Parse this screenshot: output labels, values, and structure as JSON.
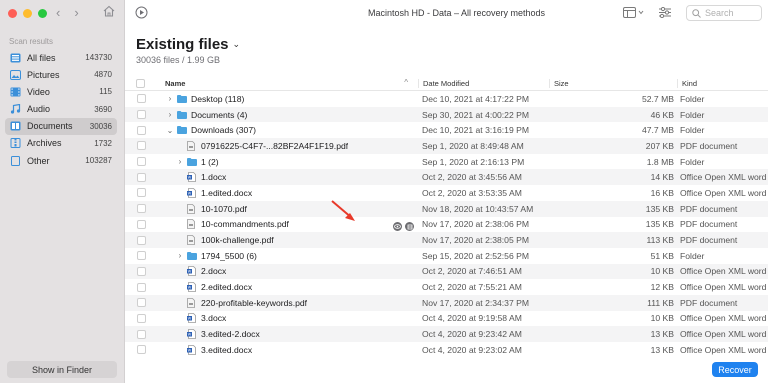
{
  "window": {
    "title": "Macintosh HD - Data – All recovery methods"
  },
  "search": {
    "placeholder": "Search"
  },
  "sidebar": {
    "header": "Scan results",
    "items": [
      {
        "label": "All files",
        "count": "143730",
        "icon": "all-files-icon"
      },
      {
        "label": "Pictures",
        "count": "4870",
        "icon": "pictures-icon"
      },
      {
        "label": "Video",
        "count": "115",
        "icon": "video-icon"
      },
      {
        "label": "Audio",
        "count": "3690",
        "icon": "audio-icon"
      },
      {
        "label": "Documents",
        "count": "30036",
        "icon": "documents-icon",
        "active": true
      },
      {
        "label": "Archives",
        "count": "1732",
        "icon": "archives-icon"
      },
      {
        "label": "Other",
        "count": "103287",
        "icon": "other-icon"
      }
    ],
    "finder_button": "Show in Finder"
  },
  "main": {
    "title": "Existing files",
    "subtitle": "30036 files / 1.99 GB"
  },
  "table": {
    "columns": {
      "name": "Name",
      "date": "Date Modified",
      "size": "Size",
      "kind": "Kind"
    },
    "rows": [
      {
        "name": "Desktop (118)",
        "date": "Dec 10, 2021 at 4:17:22 PM",
        "size": "52.7 MB",
        "kind": "Folder",
        "type": "folder",
        "disc": "›"
      },
      {
        "name": "Documents (4)",
        "date": "Sep 30, 2021 at 4:00:22 PM",
        "size": "46 KB",
        "kind": "Folder",
        "type": "folder",
        "disc": "›"
      },
      {
        "name": "Downloads (307)",
        "date": "Dec 10, 2021 at 3:16:19 PM",
        "size": "47.7 MB",
        "kind": "Folder",
        "type": "folder",
        "disc": "⌄"
      },
      {
        "name": "07916225-C4F7-...82BF2A4F1F19.pdf",
        "date": "Sep 1, 2020 at 8:49:48 AM",
        "size": "207 KB",
        "kind": "PDF document",
        "type": "pdf"
      },
      {
        "name": "1 (2)",
        "date": "Sep 1, 2020 at 2:16:13 PM",
        "size": "1.8 MB",
        "kind": "Folder",
        "type": "folder",
        "disc": "›"
      },
      {
        "name": "1.docx",
        "date": "Oct 2, 2020 at 3:45:56 AM",
        "size": "14 KB",
        "kind": "Office Open XML word proce...",
        "type": "docx"
      },
      {
        "name": "1.edited.docx",
        "date": "Oct 2, 2020 at 3:53:35 AM",
        "size": "16 KB",
        "kind": "Office Open XML word proce...",
        "type": "docx"
      },
      {
        "name": "10-1070.pdf",
        "date": "Nov 18, 2020 at 10:43:57 AM",
        "size": "135 KB",
        "kind": "PDF document",
        "type": "pdf"
      },
      {
        "name": "10-commandments.pdf",
        "date": "Nov 17, 2020 at 2:38:06 PM",
        "size": "135 KB",
        "kind": "PDF document",
        "type": "pdf",
        "actions": true
      },
      {
        "name": "100k-challenge.pdf",
        "date": "Nov 17, 2020 at 2:38:05 PM",
        "size": "113 KB",
        "kind": "PDF document",
        "type": "pdf"
      },
      {
        "name": "1794_5500 (6)",
        "date": "Sep 15, 2020 at 2:52:56 PM",
        "size": "51 KB",
        "kind": "Folder",
        "type": "folder",
        "disc": "›"
      },
      {
        "name": "2.docx",
        "date": "Oct 2, 2020 at 7:46:51 AM",
        "size": "10 KB",
        "kind": "Office Open XML word proce...",
        "type": "docx"
      },
      {
        "name": "2.edited.docx",
        "date": "Oct 2, 2020 at 7:55:21 AM",
        "size": "12 KB",
        "kind": "Office Open XML word proce...",
        "type": "docx"
      },
      {
        "name": "220-profitable-keywords.pdf",
        "date": "Nov 17, 2020 at 2:34:37 PM",
        "size": "111 KB",
        "kind": "PDF document",
        "type": "pdf"
      },
      {
        "name": "3.docx",
        "date": "Oct 4, 2020 at 9:19:58 AM",
        "size": "10 KB",
        "kind": "Office Open XML word proce...",
        "type": "docx"
      },
      {
        "name": "3.edited-2.docx",
        "date": "Oct 4, 2020 at 9:23:42 AM",
        "size": "13 KB",
        "kind": "Office Open XML word proce...",
        "type": "docx"
      },
      {
        "name": "3.edited.docx",
        "date": "Oct 4, 2020 at 9:23:02 AM",
        "size": "13 KB",
        "kind": "Office Open XML word proce...",
        "type": "docx"
      }
    ]
  },
  "recover_button": "Recover",
  "colors": {
    "accent": "#1f82ef",
    "folder": "#4aa3df",
    "annotation": "#e8392a"
  }
}
